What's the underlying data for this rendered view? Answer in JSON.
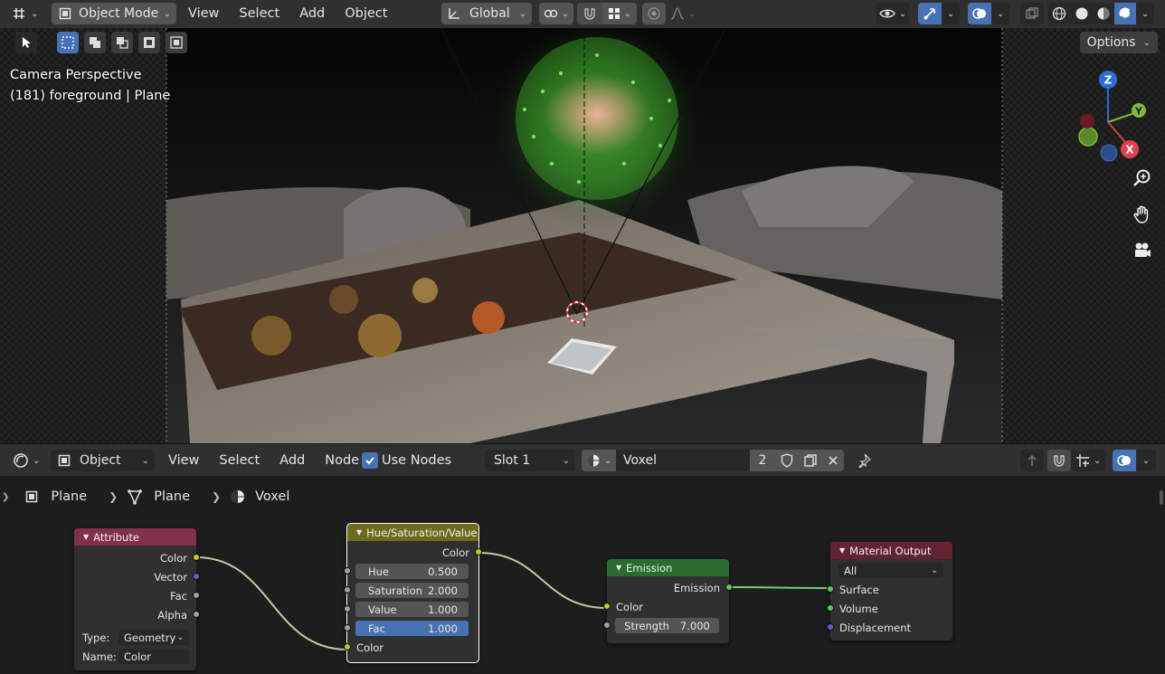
{
  "top_header": {
    "mode_label": "Object Mode",
    "menus": [
      "View",
      "Select",
      "Add",
      "Object"
    ],
    "transform_orientation": "Global"
  },
  "viewport": {
    "overlay_line1": "Camera Perspective",
    "overlay_line2": "(181) foreground | Plane",
    "options_label": "Options",
    "gizmo": {
      "z": "Z",
      "y": "Y",
      "x": "X"
    }
  },
  "node_header": {
    "editor_type": "Object",
    "menus": [
      "View",
      "Select",
      "Add",
      "Node"
    ],
    "use_nodes_label": "Use Nodes",
    "use_nodes_checked": true,
    "slot": "Slot 1",
    "material_name": "Voxel",
    "user_count": "2"
  },
  "breadcrumb": {
    "object": "Plane",
    "mesh": "Plane",
    "material": "Voxel"
  },
  "nodes": {
    "attribute": {
      "title": "Attribute",
      "outputs": [
        "Color",
        "Vector",
        "Fac",
        "Alpha"
      ],
      "type_label": "Type:",
      "type_value": "Geometry",
      "name_label": "Name:",
      "name_value": "Color"
    },
    "hsv": {
      "title": "Hue/Saturation/Value",
      "output": "Color",
      "fields": [
        {
          "label": "Hue",
          "value": "0.500"
        },
        {
          "label": "Saturation",
          "value": "2.000"
        },
        {
          "label": "Value",
          "value": "1.000"
        },
        {
          "label": "Fac",
          "value": "1.000"
        }
      ],
      "input": "Color"
    },
    "emission": {
      "title": "Emission",
      "output": "Emission",
      "input": "Color",
      "strength_label": "Strength",
      "strength_value": "7.000"
    },
    "material_output": {
      "title": "Material Output",
      "target": "All",
      "inputs": [
        "Surface",
        "Volume",
        "Displacement"
      ]
    }
  },
  "colors": {
    "accent": "#4772b3",
    "attribute_header": "#83314a",
    "hsv_header": "#6c6c1e",
    "emission_header": "#2a6b2f",
    "output_header": "#632330",
    "socket_color": "#c7c729",
    "socket_vector": "#6363c7",
    "socket_float": "#a1a1a1",
    "socket_shader": "#63c763"
  }
}
